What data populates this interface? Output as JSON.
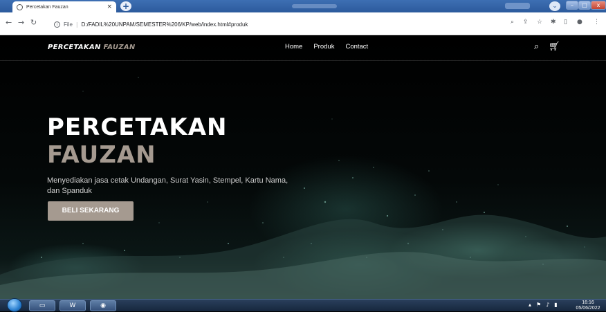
{
  "browser": {
    "tab_title": "Percetakan Fauzan",
    "tab_close": "×",
    "new_tab": "+",
    "url_prefix": "File",
    "url": "D:/FADIL%20UNPAM/SEMESTER%206/KP/web/index.html#produk",
    "window_controls": {
      "minimize": "–",
      "maximize": "□",
      "close": "x"
    }
  },
  "site": {
    "brand_primary": "PERCETAKAN",
    "brand_secondary": "FAUZAN",
    "nav": [
      "Home",
      "Produk",
      "Contact"
    ],
    "accent_color": "#a59a90"
  },
  "hero": {
    "title_line1": "PERCETAKAN",
    "title_line2": "FAUZAN",
    "description": "Menyediakan jasa cetak Undangan, Surat Yasin, Stempel, Kartu Nama, dan Spanduk",
    "button_label": "BELI SEKARANG"
  },
  "taskbar": {
    "word_label": "W",
    "time": "16:16",
    "date": "05/06/2022"
  }
}
